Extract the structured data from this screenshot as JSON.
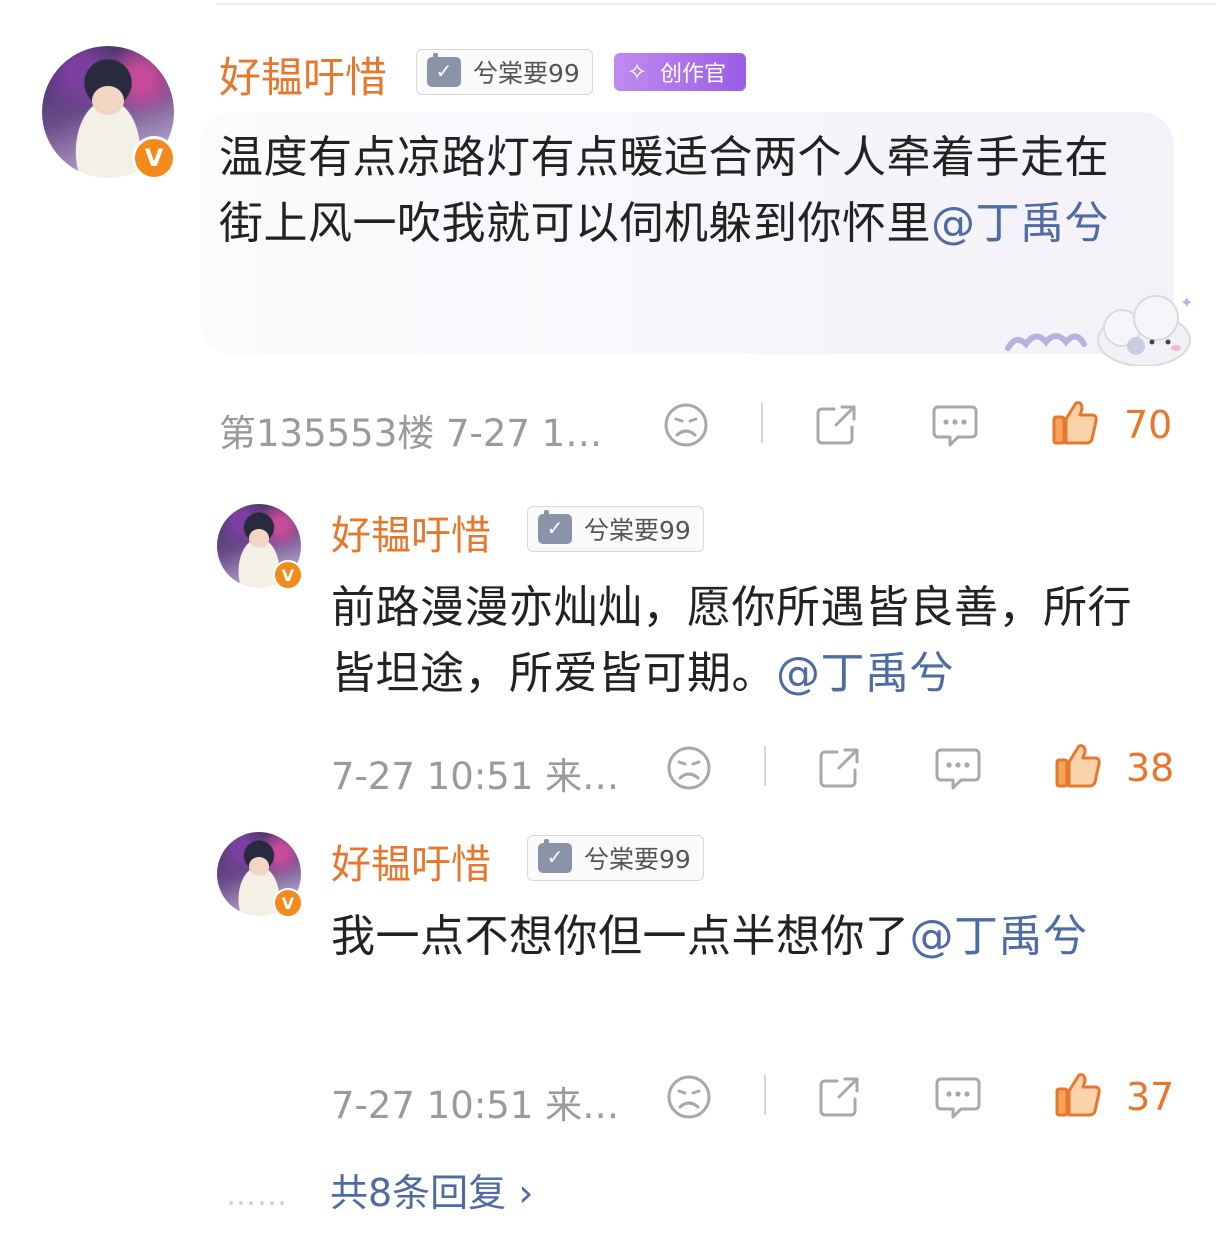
{
  "comment": {
    "username": "好韫吁惜",
    "fan_badge_label": "兮棠要99",
    "creator_badge_label": "创作官",
    "text_parts": [
      "温度有点凉路灯有点暖适合两个人牵着手走在街上风一吹我就可以伺机躲到你怀里",
      "@丁禹兮"
    ],
    "meta": "第135553楼 7-27 1…",
    "like_count": "70"
  },
  "replies": [
    {
      "username": "好韫吁惜",
      "fan_badge_label": "兮棠要99",
      "text_parts": [
        "前路漫漫亦灿灿，愿你所遇皆良善，所行皆坦途，所爱皆可期。",
        "@丁禹兮"
      ],
      "meta": "7-27 10:51 来…",
      "like_count": "38"
    },
    {
      "username": "好韫吁惜",
      "fan_badge_label": "兮棠要99",
      "text_parts": [
        "我一点不想你但一点半想你了",
        "@丁禹兮"
      ],
      "meta": "7-27 10:51 来…",
      "like_count": "37"
    }
  ],
  "more_replies": {
    "dots": "……",
    "label": "共8条回复 ›"
  },
  "icons": {
    "verified": "v-badge-icon",
    "dislike": "sad-face-icon",
    "share": "share-icon",
    "comment": "comment-icon",
    "like": "thumbs-up-icon"
  },
  "colors": {
    "username": "#e8772e",
    "mention": "#4f6ba3",
    "like": "#e8772e",
    "meta": "#9a9a9a"
  }
}
